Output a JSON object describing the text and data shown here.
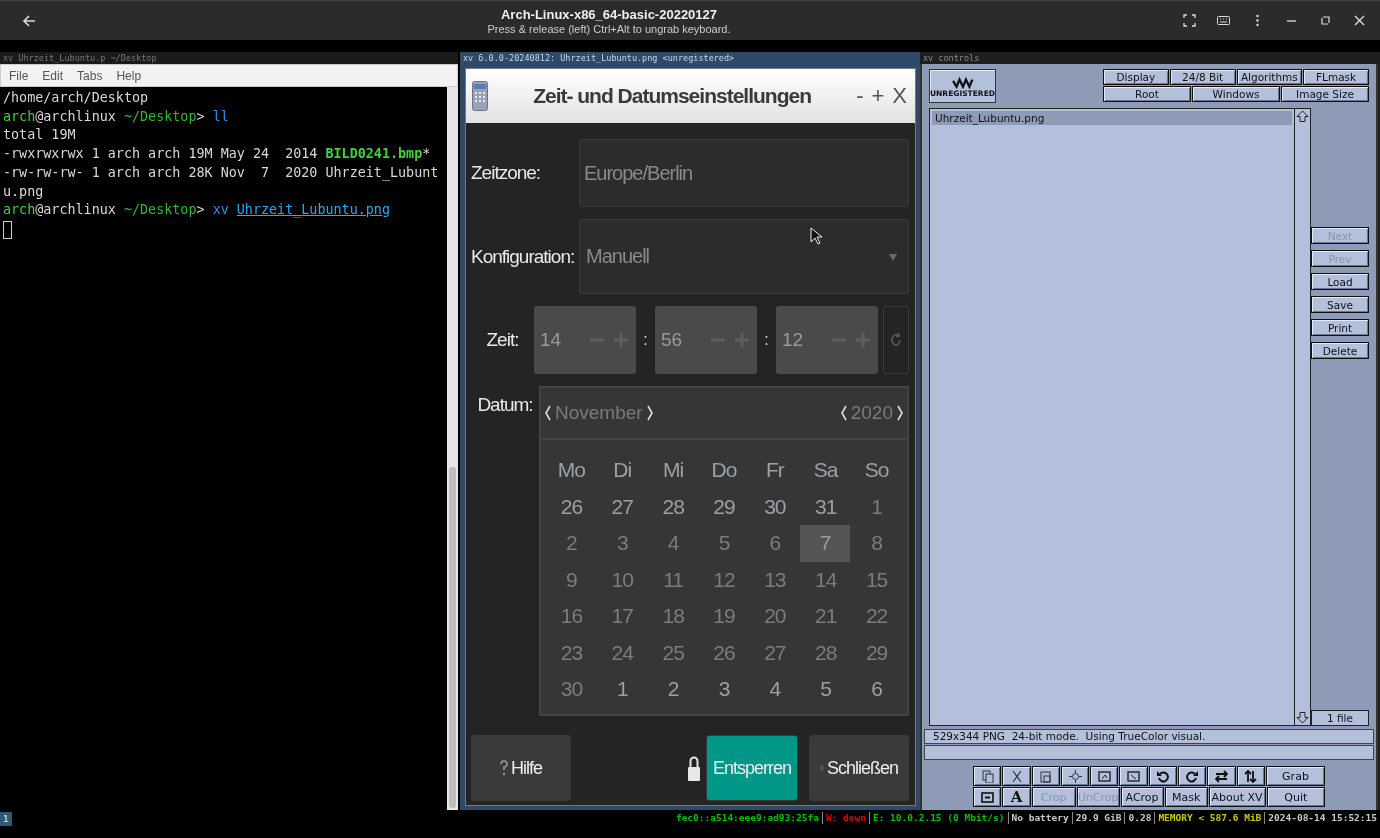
{
  "top_bar": {
    "title": "Arch-Linux-x86_64-basic-20220127",
    "subtitle": "Press & release (left) Ctrl+Alt to ungrab keyboard."
  },
  "terminal": {
    "title": "xv Uhrzeit_Lubuntu.p ~/Desktop",
    "menu": [
      "File",
      "Edit",
      "Tabs",
      "Help"
    ],
    "lines": [
      [
        {
          "text": "/home/arch/Desktop",
          "kind": "plain"
        }
      ],
      [
        {
          "text": "arch",
          "kind": "user"
        },
        {
          "text": "@archlinux ",
          "kind": "plain"
        },
        {
          "text": "~/Desktop",
          "kind": "path"
        },
        {
          "text": "> ",
          "kind": "plain"
        },
        {
          "text": "ll",
          "kind": "command"
        }
      ],
      [
        {
          "text": "total 19M",
          "kind": "plain"
        }
      ],
      [
        {
          "text": "-rwxrwxrwx 1 arch arch 19M May 24  2014 ",
          "kind": "plain"
        },
        {
          "text": "BILD0241.bmp",
          "kind": "executable"
        },
        {
          "text": "*",
          "kind": "plain"
        }
      ],
      [
        {
          "text": "-rw-rw-rw- 1 arch arch 28K Nov  7  2020 Uhrzeit_Lubunt",
          "kind": "plain"
        }
      ],
      [
        {
          "text": "u.png",
          "kind": "plain"
        }
      ],
      [
        {
          "text": "arch",
          "kind": "user"
        },
        {
          "text": "@archlinux ",
          "kind": "plain"
        },
        {
          "text": "~/Desktop",
          "kind": "path"
        },
        {
          "text": "> ",
          "kind": "plain"
        },
        {
          "text": "xv ",
          "kind": "command"
        },
        {
          "text": "Uhrzeit_Lubuntu.png",
          "kind": "link"
        }
      ]
    ]
  },
  "image_window": {
    "title": "xv 6.0.0-20240812: Uhrzeit_Lubuntu.png <unregistered>",
    "dialog": {
      "title": "Zeit- und Datumseinstellungen",
      "window_buttons": [
        "-",
        "+",
        "X"
      ],
      "locked": true,
      "timezone": {
        "label": "Zeitzone:",
        "value": "Europe/Berlin"
      },
      "configuration": {
        "label": "Konfiguration:",
        "value": "Manuell"
      },
      "time": {
        "label": "Zeit:",
        "separator": ":",
        "fields": [
          {
            "value": "14"
          },
          {
            "value": "56"
          },
          {
            "value": "12"
          }
        ]
      },
      "date": {
        "label": "Datum:",
        "month": "November",
        "year": "2020",
        "weekdays": [
          "Mo",
          "Di",
          "Mi",
          "Do",
          "Fr",
          "Sa",
          "So"
        ],
        "weeks": [
          [
            {
              "day": "26",
              "dim": false,
              "selected": false
            },
            {
              "day": "27",
              "dim": false,
              "selected": false
            },
            {
              "day": "28",
              "dim": false,
              "selected": false
            },
            {
              "day": "29",
              "dim": false,
              "selected": false
            },
            {
              "day": "30",
              "dim": false,
              "selected": false
            },
            {
              "day": "31",
              "dim": false,
              "selected": false
            },
            {
              "day": "1",
              "dim": true,
              "selected": false
            }
          ],
          [
            {
              "day": "2",
              "dim": true,
              "selected": false
            },
            {
              "day": "3",
              "dim": true,
              "selected": false
            },
            {
              "day": "4",
              "dim": true,
              "selected": false
            },
            {
              "day": "5",
              "dim": true,
              "selected": false
            },
            {
              "day": "6",
              "dim": true,
              "selected": false
            },
            {
              "day": "7",
              "dim": true,
              "selected": true
            },
            {
              "day": "8",
              "dim": true,
              "selected": false
            }
          ],
          [
            {
              "day": "9",
              "dim": true,
              "selected": false
            },
            {
              "day": "10",
              "dim": true,
              "selected": false
            },
            {
              "day": "11",
              "dim": true,
              "selected": false
            },
            {
              "day": "12",
              "dim": true,
              "selected": false
            },
            {
              "day": "13",
              "dim": true,
              "selected": false
            },
            {
              "day": "14",
              "dim": true,
              "selected": false
            },
            {
              "day": "15",
              "dim": true,
              "selected": false
            }
          ],
          [
            {
              "day": "16",
              "dim": true,
              "selected": false
            },
            {
              "day": "17",
              "dim": true,
              "selected": false
            },
            {
              "day": "18",
              "dim": true,
              "selected": false
            },
            {
              "day": "19",
              "dim": true,
              "selected": false
            },
            {
              "day": "20",
              "dim": true,
              "selected": false
            },
            {
              "day": "21",
              "dim": true,
              "selected": false
            },
            {
              "day": "22",
              "dim": true,
              "selected": false
            }
          ],
          [
            {
              "day": "23",
              "dim": true,
              "selected": false
            },
            {
              "day": "24",
              "dim": true,
              "selected": false
            },
            {
              "day": "25",
              "dim": true,
              "selected": false
            },
            {
              "day": "26",
              "dim": true,
              "selected": false
            },
            {
              "day": "27",
              "dim": true,
              "selected": false
            },
            {
              "day": "28",
              "dim": true,
              "selected": false
            },
            {
              "day": "29",
              "dim": true,
              "selected": false
            }
          ],
          [
            {
              "day": "30",
              "dim": true,
              "selected": false
            },
            {
              "day": "1",
              "dim": false,
              "selected": false
            },
            {
              "day": "2",
              "dim": false,
              "selected": false
            },
            {
              "day": "3",
              "dim": false,
              "selected": false
            },
            {
              "day": "4",
              "dim": false,
              "selected": false
            },
            {
              "day": "5",
              "dim": false,
              "selected": false
            },
            {
              "day": "6",
              "dim": false,
              "selected": false
            }
          ]
        ]
      },
      "buttons": [
        {
          "kind": "help",
          "label": "Hilfe"
        },
        {
          "kind": "unlock",
          "label": "Entsperren"
        },
        {
          "kind": "close",
          "label": "Schließen"
        }
      ]
    }
  },
  "controls": {
    "title": "xv controls",
    "logo": "UNREGISTERED",
    "menu_rows": [
      [
        "Display",
        "24/8 Bit",
        "Algorithms",
        "FLmask"
      ],
      [
        "Root",
        "Windows",
        "Image Size"
      ]
    ],
    "files": [
      {
        "name": "Uhrzeit_Lubuntu.png",
        "selected": true
      }
    ],
    "side_buttons": [
      {
        "label": "Next",
        "disabled": true
      },
      {
        "label": "Prev",
        "disabled": true
      },
      {
        "label": "Load",
        "disabled": false
      },
      {
        "label": "Save",
        "disabled": false
      },
      {
        "label": "Print",
        "disabled": false
      },
      {
        "label": "Delete",
        "disabled": false
      }
    ],
    "file_count": "1 file",
    "info_lines": [
      "529x344 PNG  24-bit mode.  Using TrueColor visual."
    ],
    "tool_rows": [
      [
        {
          "kind": "icon",
          "disabled": false
        },
        {
          "kind": "icon",
          "disabled": false
        },
        {
          "kind": "icon",
          "disabled": false
        },
        {
          "kind": "icon",
          "disabled": false
        },
        {
          "kind": "icon",
          "disabled": false
        },
        {
          "kind": "icon",
          "disabled": false
        },
        {
          "kind": "icon",
          "disabled": false
        },
        {
          "kind": "icon",
          "disabled": false
        },
        {
          "kind": "icon",
          "disabled": false
        },
        {
          "kind": "icon",
          "disabled": false
        },
        {
          "kind": "text",
          "label": "Grab",
          "disabled": false
        }
      ],
      [
        {
          "kind": "icon",
          "disabled": false
        },
        {
          "kind": "glyph",
          "label": "A",
          "disabled": false
        },
        {
          "kind": "text",
          "label": "Crop",
          "disabled": true
        },
        {
          "kind": "text",
          "label": "UnCrop",
          "disabled": true
        },
        {
          "kind": "text",
          "label": "ACrop",
          "disabled": false
        },
        {
          "kind": "text",
          "label": "Mask",
          "disabled": false
        },
        {
          "kind": "text",
          "label": "About XV",
          "disabled": false
        },
        {
          "kind": "text",
          "label": "Quit",
          "disabled": false
        }
      ]
    ]
  },
  "status_bar": {
    "workspace": "1",
    "items": [
      {
        "text": "fec0::a514:eee9:ad93:25fa",
        "color": "#00c000"
      },
      {
        "text": "W: down",
        "color": "#e00000"
      },
      {
        "text": "E: 10.0.2.15 (0 Mbit/s)",
        "color": "#00c000"
      },
      {
        "text": "No battery",
        "color": "#c8c8c8"
      },
      {
        "text": "29.9 GiB",
        "color": "#c8c8c8"
      },
      {
        "text": "0.28",
        "color": "#c8c8c8"
      },
      {
        "text": "MEMORY < 587.6 MiB",
        "color": "#c8c800"
      },
      {
        "text": "2024-08-14 15:52:15",
        "color": "#c8c8c8"
      }
    ]
  }
}
